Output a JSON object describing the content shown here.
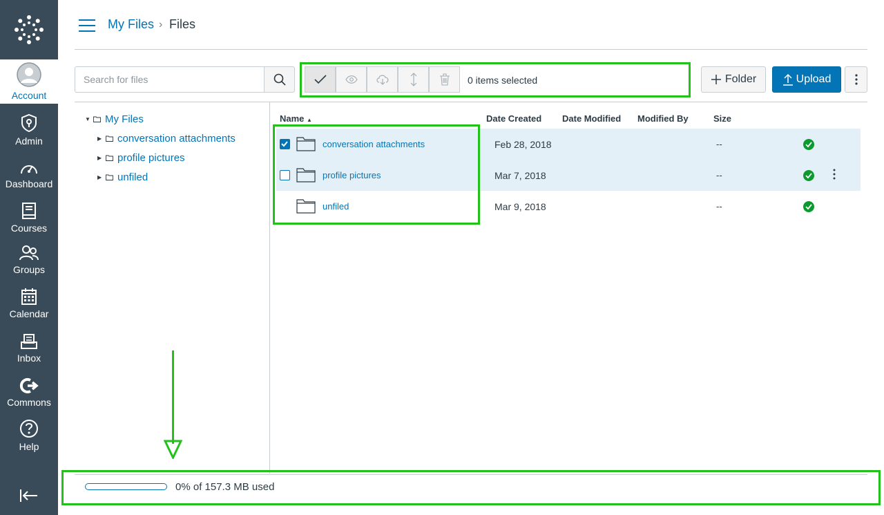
{
  "nav": {
    "items": [
      {
        "label": "Account",
        "icon": "account-avatar-icon"
      },
      {
        "label": "Admin",
        "icon": "admin-shield-icon"
      },
      {
        "label": "Dashboard",
        "icon": "dashboard-speedometer-icon"
      },
      {
        "label": "Courses",
        "icon": "courses-book-icon"
      },
      {
        "label": "Groups",
        "icon": "groups-people-icon"
      },
      {
        "label": "Calendar",
        "icon": "calendar-icon"
      },
      {
        "label": "Inbox",
        "icon": "inbox-icon"
      },
      {
        "label": "Commons",
        "icon": "commons-icon"
      },
      {
        "label": "Help",
        "icon": "help-icon"
      }
    ],
    "collapse_icon": "collapse-nav-icon"
  },
  "breadcrumb": {
    "root": "My Files",
    "separator": "›",
    "current": "Files"
  },
  "search": {
    "placeholder": "Search for files",
    "value": ""
  },
  "toolbar": {
    "selected_text": "0 items selected",
    "folder_label": "Folder",
    "upload_label": "Upload"
  },
  "tree": {
    "root": "My Files",
    "children": [
      "conversation attachments",
      "profile pictures",
      "unfiled"
    ]
  },
  "table": {
    "columns": [
      "Name",
      "Date Created",
      "Date Modified",
      "Modified By",
      "Size"
    ],
    "sort_indicator": "▲",
    "rows": [
      {
        "name": "conversation attachments",
        "date_created": "Feb 28, 2018",
        "date_modified": "",
        "modified_by": "",
        "size": "--",
        "checked": true
      },
      {
        "name": "profile pictures",
        "date_created": "Mar 7, 2018",
        "date_modified": "",
        "modified_by": "",
        "size": "--",
        "checked": false
      },
      {
        "name": "unfiled",
        "date_created": "Mar 9, 2018",
        "date_modified": "",
        "modified_by": "",
        "size": "--",
        "checked": false
      }
    ]
  },
  "quota": {
    "text": "0% of 157.3 MB used",
    "fraction": 0.0
  },
  "colors": {
    "nav_bg": "#394b58",
    "link": "#0374b5",
    "annotation": "#22c21b",
    "success": "#0b9a2f"
  }
}
